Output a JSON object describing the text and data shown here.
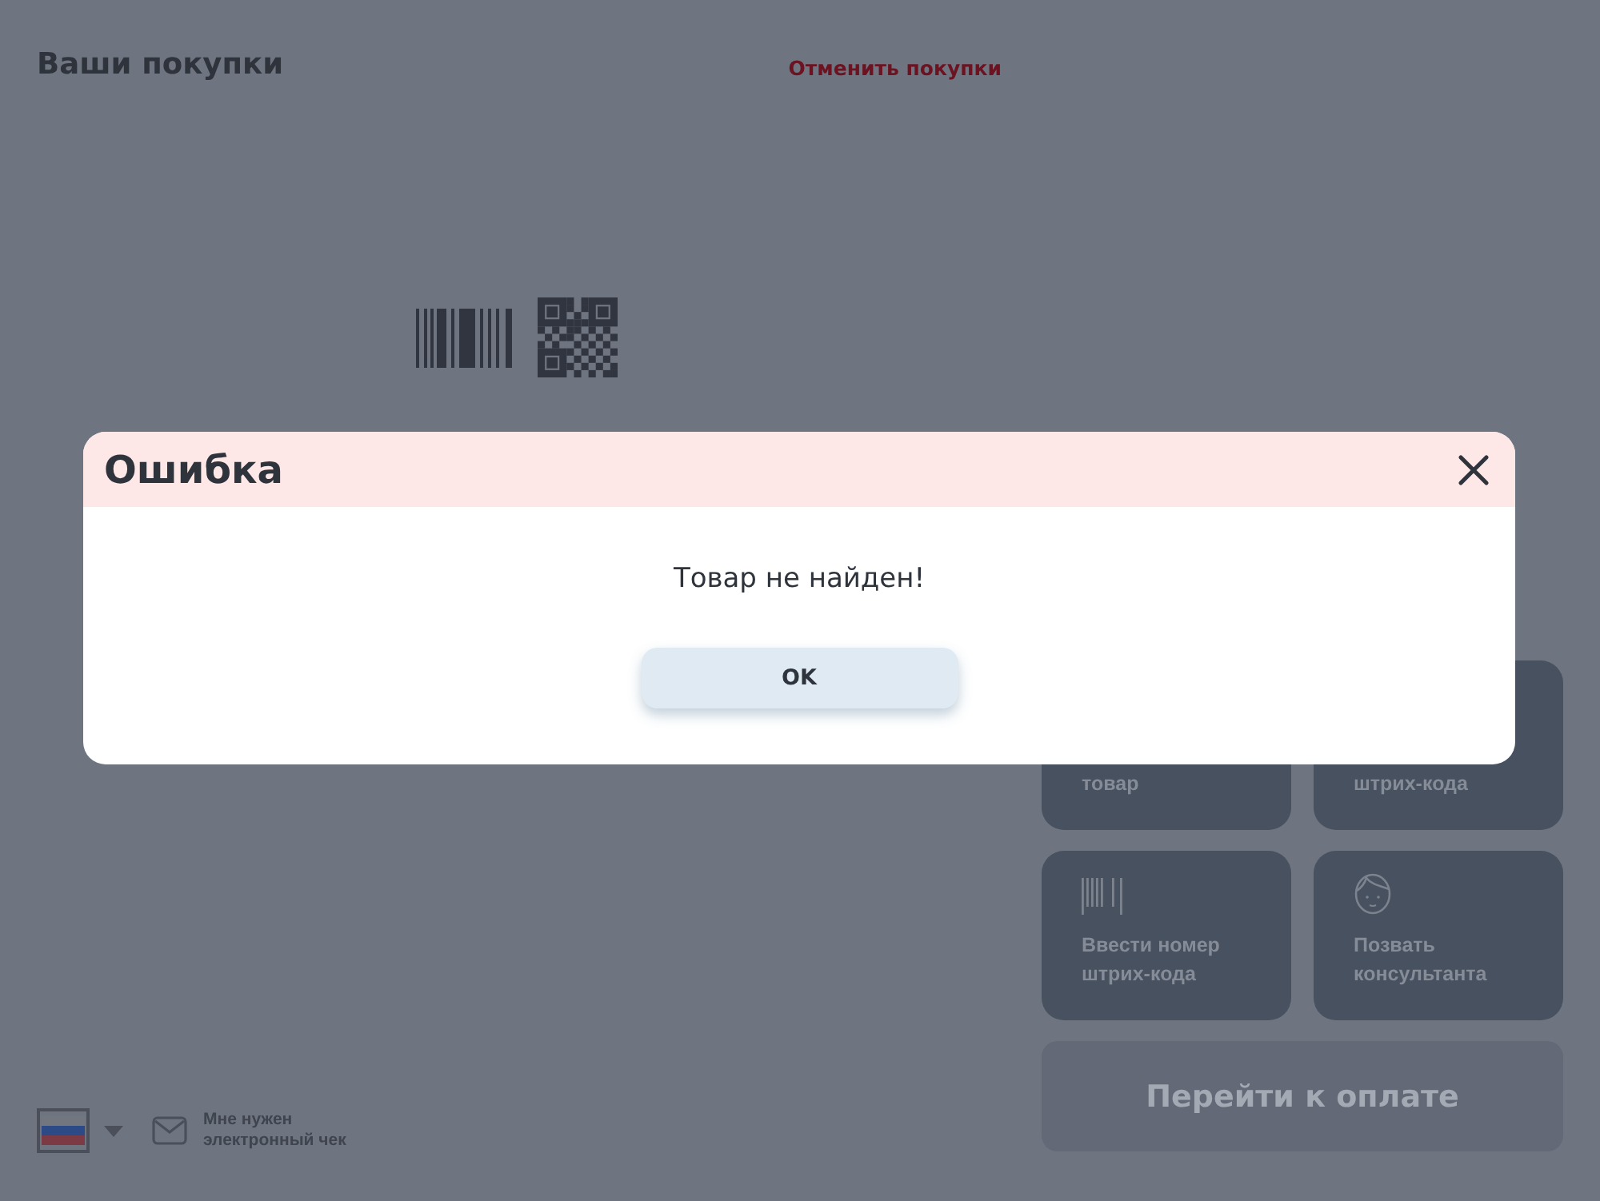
{
  "header": {
    "title": "Ваши покупки",
    "cancel_link": "Отменить покупки"
  },
  "actions": [
    {
      "kind": "covered",
      "label": "товар"
    },
    {
      "kind": "covered",
      "label": "штрих-кода"
    },
    {
      "kind": "barcode",
      "label": "Ввести номер штрих-кода"
    },
    {
      "kind": "consultant",
      "label": "Позвать консультанта"
    }
  ],
  "pay_button": {
    "label": "Перейти к оплате",
    "disabled": true
  },
  "footer": {
    "receipt_label": "Мне нужен электронный чек"
  },
  "dialog": {
    "title": "Ошибка",
    "message": "Товар не найден!",
    "button": "OK"
  }
}
